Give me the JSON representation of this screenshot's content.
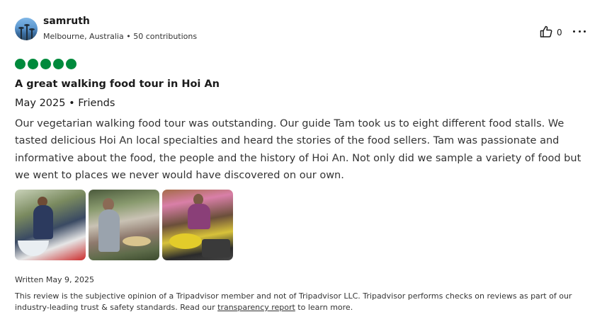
{
  "user": {
    "name": "samruth",
    "location": "Melbourne, Australia",
    "separator": " • ",
    "contributions": "50 contributions"
  },
  "actions": {
    "helpful_count": "0",
    "helpful_icon": "thumbs-up-icon",
    "more_icon": "more-options-icon"
  },
  "review": {
    "rating": 5,
    "rating_color": "#008a3c",
    "title": "A great walking food tour in Hoi An",
    "date_trip": "May 2025 • Friends",
    "text": "Our vegetarian walking food tour was outstanding. Our guide Tam took us to eight different food stalls. We tasted delicious Hoi An local specialties and heard the stories of the food sellers. Tam was passionate and informative about the food, the people and the history of Hoi An. Not only did we sample a variety of food but we went to places we never would have discovered on our own.",
    "photos_count": 3,
    "written": "Written May 9, 2025"
  },
  "disclaimer": {
    "before": "This review is the subjective opinion of a Tripadvisor member and not of Tripadvisor LLC. Tripadvisor performs checks on reviews as part of our industry-leading trust & safety standards. Read our ",
    "link": "transparency report",
    "after": " to learn more."
  }
}
